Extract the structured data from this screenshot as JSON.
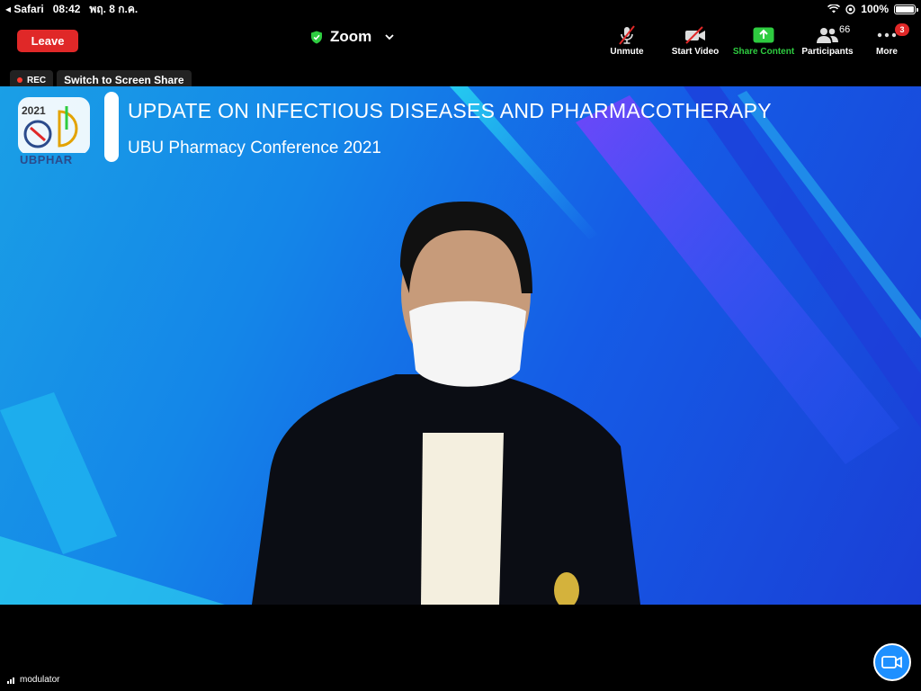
{
  "status_bar": {
    "back_app": "Safari",
    "time": "08:42",
    "date": "พฤ. 8 ก.ค.",
    "battery": "100%"
  },
  "toolbar": {
    "leave_label": "Leave",
    "title": "Zoom",
    "unmute_label": "Unmute",
    "start_video_label": "Start Video",
    "share_content_label": "Share Content",
    "participants_label": "Participants",
    "participants_count": "66",
    "more_label": "More",
    "more_badge": "3"
  },
  "meeting": {
    "rec_label": "REC",
    "switch_label": "Switch to Screen Share",
    "slide_title": "UPDATE ON INFECTIOUS DISEASES AND PHARMACOTHERAPY",
    "slide_subtitle": "UBU Pharmacy Conference 2021",
    "logo_year": "2021",
    "logo_text": "UBPHAR",
    "speaker_name": "modulator"
  },
  "colors": {
    "leave": "#e02828",
    "share_green": "#2ecc40",
    "background_blue": "#1486e8"
  }
}
